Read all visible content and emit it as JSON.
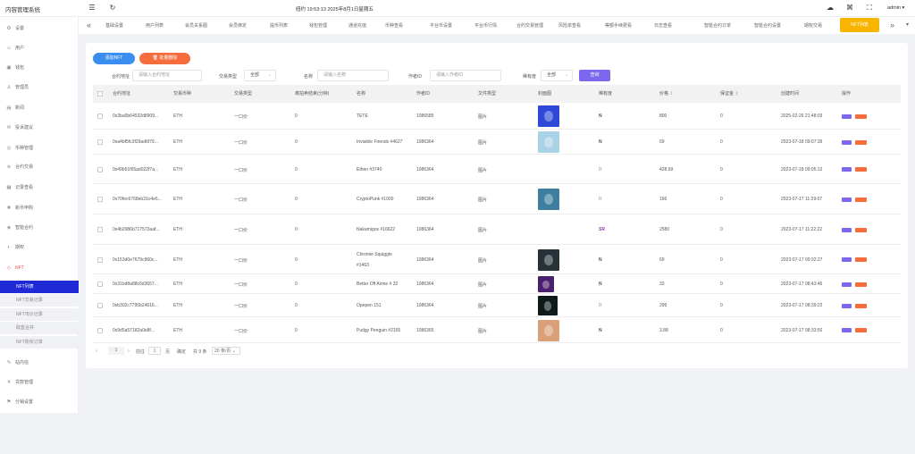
{
  "app": {
    "title": "内容管理系统",
    "clock": "纽约 19:53:13 2025年8月1日星期五",
    "user": "admin"
  },
  "tabs": [
    "基础设置",
    "用户列表",
    "会员关系图",
    "会员绑定",
    "提币列表",
    "钱包管理",
    "通道充值",
    "币种查看",
    "平台币设置",
    "平台币行情",
    "合约交易管理",
    "风险单查看",
    "等额手续费看",
    "日志查看",
    "智能合约订单",
    "智能合约设置",
    "期权交易",
    "NFT列表"
  ],
  "active_tab": "NFT列表",
  "sidebar": {
    "items": [
      {
        "label": "设置",
        "icon": "gear-icon"
      },
      {
        "label": "用户",
        "icon": "user-icon"
      },
      {
        "label": "钱包",
        "icon": "wallet-icon"
      },
      {
        "label": "管理员",
        "icon": "admin-icon"
      },
      {
        "label": "新闻",
        "icon": "news-icon"
      },
      {
        "label": "投诉建议",
        "icon": "feedback-icon"
      },
      {
        "label": "币种管理",
        "icon": "coin-icon"
      },
      {
        "label": "合约交易",
        "icon": "contract-icon"
      },
      {
        "label": "记录查看",
        "icon": "record-icon"
      },
      {
        "label": "新币申购",
        "icon": "newcoin-icon"
      },
      {
        "label": "智能合约",
        "icon": "smart-contract-icon"
      },
      {
        "label": "期权",
        "icon": "option-icon"
      },
      {
        "label": "NFT",
        "icon": "nft-icon"
      }
    ],
    "nft_sub": [
      "NFT列表",
      "NFT交易记录",
      "NFT市价记录",
      "取盒合并",
      "NFT购买订单"
    ],
    "bottom_items": [
      {
        "label": "站内信",
        "icon": "message-icon"
      },
      {
        "label": "贷款管理",
        "icon": "loan-icon"
      },
      {
        "label": "分销设置",
        "icon": "distribution-icon"
      }
    ]
  },
  "toolbar": {
    "add_label": "添加NFT",
    "batch_delete_label": "批量删除"
  },
  "filters": {
    "contract_label": "合约地址",
    "contract_placeholder": "请输入合约地址",
    "type_label": "交易类型",
    "type_value": "全部",
    "name_label": "名称",
    "name_placeholder": "请输入名称",
    "author_label": "作者ID",
    "author_placeholder": "请输入作者ID",
    "rarity_label": "稀有度",
    "rarity_value": "全部",
    "search_label": "查询"
  },
  "table": {
    "columns": [
      "合约地址",
      "交易币种",
      "交易类型",
      "离拍卖结束(分钟)",
      "名称",
      "作者ID",
      "文件类型",
      "封面图",
      "稀有度",
      "价格",
      "保证金",
      "创建时间",
      "操作"
    ],
    "rows": [
      {
        "contract": "0x3ba5b64532d8909...",
        "coin": "ETH",
        "type": "一口价",
        "minutes": "0",
        "name": "TETE",
        "author": "1086585",
        "file": "图片",
        "rarity": "N",
        "price": "800",
        "deposit": "0",
        "created": "2025-02-26 21:48:03",
        "cover": "#2f48d8"
      },
      {
        "contract": "0xa4bf5fc3f29ad6f79...",
        "coin": "ETH",
        "type": "一口价",
        "minutes": "0",
        "name": "Invisible Friends #4627",
        "author": "1086364",
        "file": "图片",
        "rarity": "N",
        "price": "69",
        "deposit": "0",
        "created": "2023-07-18 09:07:39",
        "cover": "#a9d2e6"
      },
      {
        "contract": "0x49b51f65ad022f7a...",
        "coin": "ETH",
        "type": "一口价",
        "minutes": "0",
        "name": "Ethen #3740",
        "author": "1086364",
        "file": "图片",
        "rarity": "R",
        "price": "428.69",
        "deposit": "0",
        "created": "2023-07-18 09:05:12",
        "cover": ""
      },
      {
        "contract": "0x70fec6768eb31c4e6...",
        "coin": "ETH",
        "type": "一口价",
        "minutes": "0",
        "name": "CryptoPunk #1000",
        "author": "1086364",
        "file": "图片",
        "rarity": "R",
        "price": "166",
        "deposit": "0",
        "created": "2023-07-17 11:29:07",
        "cover": "#3e7fa0"
      },
      {
        "contract": "0x4b2986b717573aaf...",
        "coin": "ETH",
        "type": "一口价",
        "minutes": "0",
        "name": "Nakamigos #16622",
        "author": "1086364",
        "file": "图片",
        "rarity": "SR",
        "price": "2580",
        "deposit": "0",
        "created": "2023-07-17 11:22:22",
        "cover": ""
      },
      {
        "contract": "0x153d0e7679c960c...",
        "coin": "ETH",
        "type": "一口价",
        "minutes": "0",
        "name": "Chromie Squiggle #1463",
        "author": "1086364",
        "file": "图片",
        "rarity": "N",
        "price": "69",
        "deposit": "0",
        "created": "2023-07-17 09:32:27",
        "cover": "#263238"
      },
      {
        "contract": "0x31bd8a88c6d3657...",
        "coin": "ETH",
        "type": "一口价",
        "minutes": "0",
        "name": "Better Off Alone # 32",
        "author": "1086364",
        "file": "图片",
        "rarity": "N",
        "price": "33",
        "deposit": "0",
        "created": "2023-07-17 08:43:46",
        "cover": "#4a1f6e"
      },
      {
        "contract": "0xb302c7795b24616...",
        "coin": "ETH",
        "type": "一口价",
        "minutes": "0",
        "name": "Opepen 151",
        "author": "1086364",
        "file": "图片",
        "rarity": "R",
        "price": "299",
        "deposit": "0",
        "created": "2023-07-17 08:39:22",
        "cover": "#0e1b1b"
      },
      {
        "contract": "0x9d5a57182a0e8f...",
        "coin": "ETH",
        "type": "一口价",
        "minutes": "0",
        "name": "Pudgy Penguin #2165",
        "author": "1086365",
        "file": "图片",
        "rarity": "N",
        "price": "3.88",
        "deposit": "0",
        "created": "2023-07-17 08:33:50",
        "cover": "#d9a07a"
      }
    ]
  },
  "pager": {
    "page": "1",
    "prev_label": "前往",
    "page_input": "1",
    "page_unit": "页",
    "confirm": "确定",
    "total": "共 9 条",
    "page_size": "20 条/页"
  },
  "colors": {
    "primary": "#1f29d6",
    "accent": "#f7b500",
    "add_btn": "#3a8ef0",
    "del_btn": "#f56c3d",
    "search_btn": "#7b68ee"
  }
}
